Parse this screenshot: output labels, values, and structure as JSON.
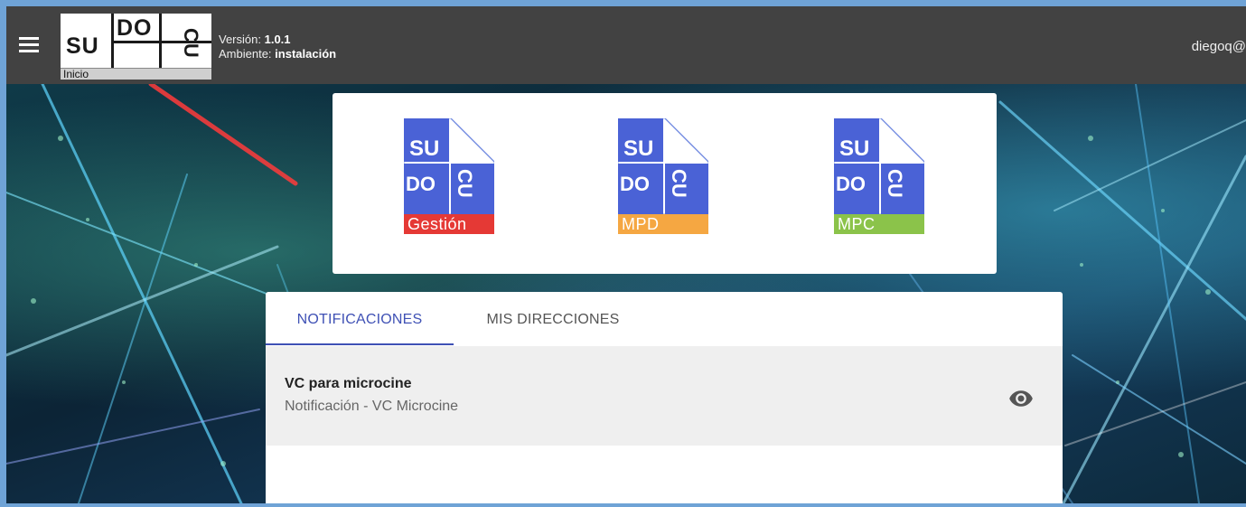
{
  "toolbar": {
    "menu_icon": "hamburger-menu-icon",
    "logo": {
      "su": "SU",
      "do": "DO",
      "cu": "CU",
      "tagline": "Inicio"
    },
    "version_label": "Versión:",
    "version_value": "1.0.1",
    "environment_label": "Ambiente:",
    "environment_value": "instalación",
    "user": "diegoq@"
  },
  "apps": [
    {
      "su": "SU",
      "do": "DO",
      "cu": "CU",
      "label": "Gestión",
      "color": "#e53935"
    },
    {
      "su": "SU",
      "do": "DO",
      "cu": "CU",
      "label": "MPD",
      "color": "#f5a742"
    },
    {
      "su": "SU",
      "do": "DO",
      "cu": "CU",
      "label": "MPC",
      "color": "#8bc34a"
    }
  ],
  "app_doc_color": "#4a62d6",
  "tabs": [
    {
      "label": "NOTIFICACIONES",
      "active": true
    },
    {
      "label": "MIS DIRECCIONES",
      "active": false
    }
  ],
  "notifications": [
    {
      "title": "VC para microcine",
      "subtitle": "Notificación - VC Microcine",
      "action_icon": "eye-icon"
    }
  ],
  "accent_color": "#3f51b5"
}
